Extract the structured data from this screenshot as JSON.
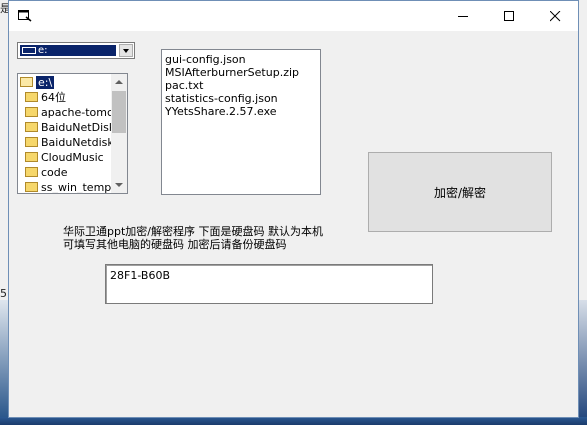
{
  "window": {
    "title": "",
    "controls": {
      "minimize_icon": "minimize-icon",
      "maximize_icon": "maximize-icon",
      "close_icon": "close-icon"
    }
  },
  "background_fragments": {
    "left_top": "是",
    "left_middle": "5"
  },
  "drive_select": {
    "selected": "e:"
  },
  "dir_list": {
    "items": [
      {
        "label": "e:\\",
        "selected": true,
        "open": true
      },
      {
        "label": "64位"
      },
      {
        "label": "apache-tomca"
      },
      {
        "label": "BaiduNetDisk"
      },
      {
        "label": "BaiduNetdiskD"
      },
      {
        "label": "CloudMusic"
      },
      {
        "label": "code"
      },
      {
        "label": "ss_win_temp"
      }
    ]
  },
  "file_list": {
    "items": [
      "gui-config.json",
      "MSIAfterburnerSetup.zip",
      "pac.txt",
      "statistics-config.json",
      "YYetsShare.2.57.exe"
    ]
  },
  "action_button": {
    "label": "加密/解密"
  },
  "description": {
    "line1": "华际卫通ppt加密/解密程序 下面是硬盘码 默认为本机",
    "line2": "可填写其他电脑的硬盘码 加密后请备份硬盘码"
  },
  "disk_code": {
    "value": "28F1-B60B"
  },
  "colors": {
    "selection": "#0a246a",
    "desktop": "#3a6ea5"
  }
}
